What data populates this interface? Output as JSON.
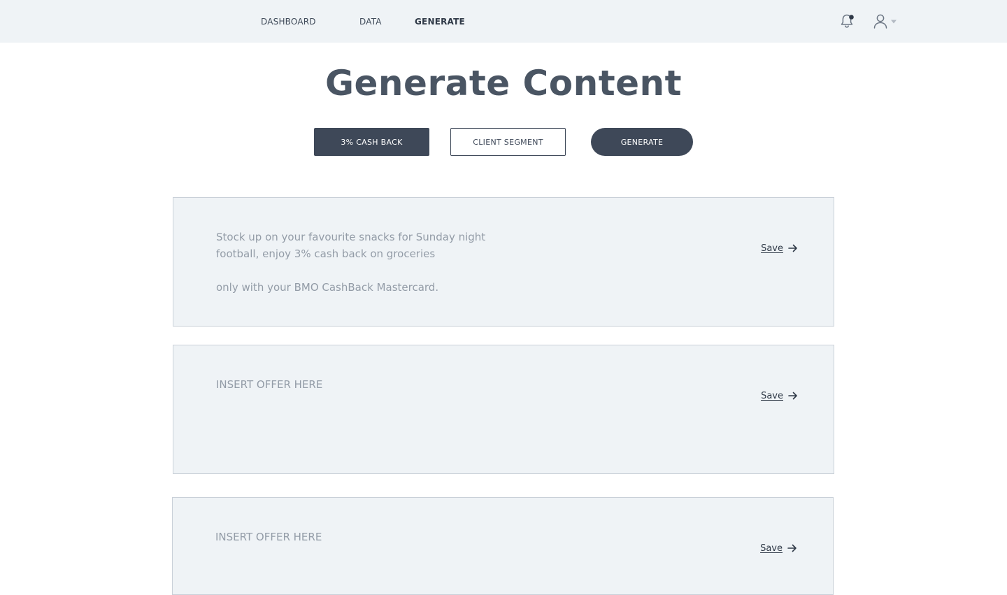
{
  "nav": {
    "items": [
      {
        "label": "DASHBOARD",
        "active": false
      },
      {
        "label": "DATA",
        "active": false
      },
      {
        "label": "GENERATE",
        "active": true
      }
    ],
    "icons": {
      "notifications": "bell-icon",
      "user": "user-icon",
      "user_menu_caret": "caret-down-icon"
    }
  },
  "page": {
    "title": "Generate Content"
  },
  "actions": {
    "offer_button": "3% CASH BACK",
    "segment_button": "CLIENT SEGMENT",
    "generate_button": "GENERATE"
  },
  "offers": [
    {
      "text": "Stock up on your favourite snacks for Sunday night\nfootball, enjoy 3% cash back on groceries\n\nonly with your BMO CashBack Mastercard.",
      "save_label": "Save"
    },
    {
      "text": "INSERT OFFER HERE",
      "save_label": "Save"
    },
    {
      "text": "INSERT OFFER HERE",
      "save_label": "Save"
    }
  ],
  "colors": {
    "nav_bg": "#eff3f6",
    "primary": "#3e4858",
    "card_bg": "#eff3f6",
    "placeholder_text": "#939ca7"
  }
}
